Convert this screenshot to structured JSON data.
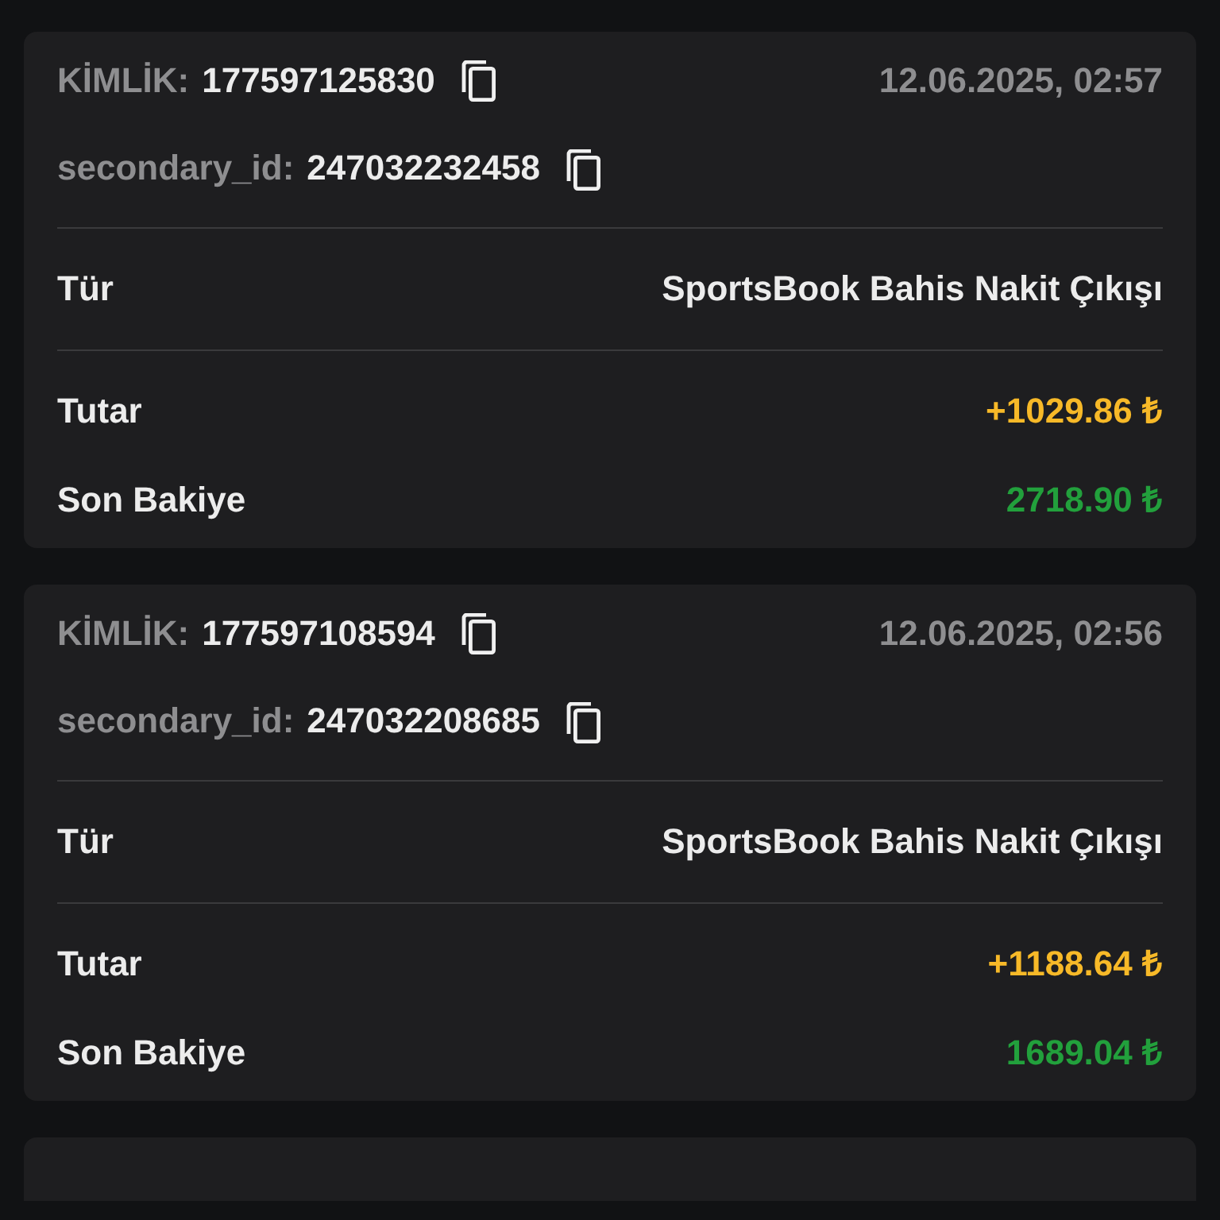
{
  "transactions": [
    {
      "kind": "full",
      "id_label": "KİMLİK:",
      "id": "177597125830",
      "date": "12.06.2025, 02:57",
      "secondary_label": "secondary_id:",
      "secondary_id": "247032232458",
      "type_label": "Tür",
      "type_value": "SportsBook Bahis Nakit Çıkışı",
      "amount_label": "Tutar",
      "amount": "+1029.86 ₺",
      "balance_label": "Son Bakiye",
      "balance": "2718.90 ₺"
    },
    {
      "kind": "full",
      "id_label": "KİMLİK:",
      "id": "177597108594",
      "date": "12.06.2025, 02:56",
      "secondary_label": "secondary_id:",
      "secondary_id": "247032208685",
      "type_label": "Tür",
      "type_value": "SportsBook Bahis Nakit Çıkışı",
      "amount_label": "Tutar",
      "amount": "+1188.64 ₺",
      "balance_label": "Son Bakiye",
      "balance": "1689.04 ₺"
    },
    {
      "kind": "partial"
    }
  ]
}
